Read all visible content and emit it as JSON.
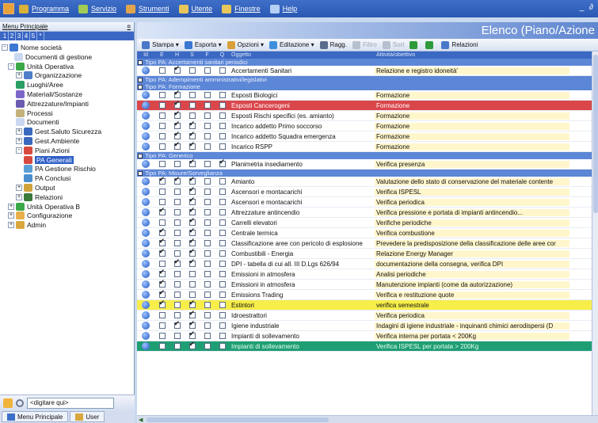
{
  "menubar": {
    "items": [
      {
        "label": "Programma",
        "icon": "program-icon",
        "color": "#d9b23a"
      },
      {
        "label": "Servizio",
        "icon": "service-icon",
        "color": "#a2cc55"
      },
      {
        "label": "Strumenti",
        "icon": "tools-icon",
        "color": "#e1a54d"
      },
      {
        "label": "Utente",
        "icon": "user-icon",
        "color": "#e7c65a"
      },
      {
        "label": "Finestre",
        "icon": "windows-icon",
        "color": "#e7c65a"
      },
      {
        "label": "Help",
        "icon": "help-icon",
        "color": "#b6cff5"
      }
    ],
    "window_controls": "_ ∂"
  },
  "left_panel": {
    "title": "Menu Principale",
    "pin": "¤",
    "tabs": [
      "1",
      "2",
      "3",
      "4",
      "5",
      "*"
    ],
    "tree": [
      {
        "label": "Nome società",
        "exp": "-",
        "icon": "company-icon",
        "color": "#3b77d3"
      },
      {
        "label": "Documenti di gestione",
        "exp": "",
        "icon": "documents-icon",
        "color": "#c9d7f0"
      },
      {
        "label": "Unità Operativa",
        "exp": "-",
        "icon": "unit-icon",
        "color": "#3aa847"
      },
      {
        "label": "Organizzazione",
        "exp": "+",
        "icon": "organization-icon",
        "color": "#4f7ec8"
      },
      {
        "label": "Luoghi/Aree",
        "exp": "",
        "icon": "places-icon",
        "color": "#2a9e63"
      },
      {
        "label": "Materiali/Sostanze",
        "exp": "",
        "icon": "materials-icon",
        "color": "#7c67c8"
      },
      {
        "label": "Attrezzature/Impianti",
        "exp": "",
        "icon": "equipment-icon",
        "color": "#6b5bb0"
      },
      {
        "label": "Processi",
        "exp": "",
        "icon": "processes-icon",
        "color": "#c3b27a"
      },
      {
        "label": "Documenti",
        "exp": "",
        "icon": "documents-icon",
        "color": "#c9d7f0"
      },
      {
        "label": "Gest.Saluto Sicurezza",
        "exp": "+",
        "icon": "safety-icon",
        "color": "#3a68bd"
      },
      {
        "label": "Gest.Ambiente",
        "exp": "+",
        "icon": "environment-icon",
        "color": "#3a68bd"
      },
      {
        "label": "Piani Azioni",
        "exp": "-",
        "icon": "action-plans-icon",
        "color": "#d84a3f"
      },
      {
        "label": "PA Generali",
        "exp": "",
        "icon": "pa-general-icon",
        "color": "#d84a3f"
      },
      {
        "label": "PA Gestione Rischio",
        "exp": "",
        "icon": "pa-risk-icon",
        "color": "#5aa0d8"
      },
      {
        "label": "PA Conclusi",
        "exp": "",
        "icon": "pa-closed-icon",
        "color": "#4b8fcf"
      },
      {
        "label": "Output",
        "exp": "+",
        "icon": "output-icon",
        "color": "#d0a33a"
      },
      {
        "label": "Relazioni",
        "exp": "+",
        "icon": "relations-icon",
        "color": "#3a7a3a"
      },
      {
        "label": "Unità Operativa B",
        "exp": "+",
        "icon": "unit-icon",
        "color": "#3aa847"
      },
      {
        "label": "Configurazione",
        "exp": "+",
        "icon": "config-icon",
        "color": "#e8b04a"
      },
      {
        "label": "Admin",
        "exp": "+",
        "icon": "admin-icon",
        "color": "#d9a73e"
      }
    ],
    "search_placeholder": "<digitare qui>",
    "bottom_tabs": [
      "Menu Principale",
      "User"
    ]
  },
  "right": {
    "title": "Elenco (Piano/Azione",
    "toolbar": [
      {
        "label": "Stampa ▾",
        "icon": "print-icon",
        "color": "#4a78c9",
        "disabled": false
      },
      {
        "label": "Esporta ▾",
        "icon": "export-icon",
        "color": "#3b77d3",
        "disabled": false
      },
      {
        "label": "Opzioni ▾",
        "icon": "options-icon",
        "color": "#d89f3a",
        "disabled": false
      },
      {
        "label": "Editazione ▾",
        "icon": "edit-icon",
        "color": "#3e8fdc",
        "disabled": false
      },
      {
        "label": "Ragg.",
        "icon": "group-icon",
        "color": "#5a6c8c",
        "disabled": false
      },
      {
        "label": "Filtro",
        "icon": "filter-icon",
        "color": "#b7c0cf",
        "disabled": true
      },
      {
        "label": "Sort",
        "icon": "sort-icon",
        "color": "#b7c0cf",
        "disabled": true
      },
      {
        "label": "",
        "icon": "down-arrow-icon",
        "color": "#2f9a3a",
        "disabled": false
      },
      {
        "label": "",
        "icon": "up-arrow-icon",
        "color": "#2f9a3a",
        "disabled": false
      },
      {
        "label": "Relazioni",
        "icon": "relations-icon",
        "color": "#4a78c9",
        "disabled": false
      }
    ],
    "columns": [
      "Id",
      "E",
      "H",
      "S",
      "F",
      "Q",
      "Oggetto",
      "Attività/obiettivo"
    ],
    "rows": [
      {
        "group": "Tipo PA: Accertamenti sanitari periodici"
      },
      {
        "c": [
          0,
          1,
          0,
          0,
          0
        ],
        "obj": "Accertamenti Sanitari",
        "act": "Relazione e registro idoneità'",
        "hl": ""
      },
      {
        "group": "Tipo PA: Adempimenti amministrativi/legislativi"
      },
      {
        "group": "Tipo PA: Formazione"
      },
      {
        "c": [
          0,
          1,
          0,
          0,
          0
        ],
        "obj": "Esposti Biologici",
        "act": "Formazione",
        "hl": ""
      },
      {
        "c": [
          0,
          1,
          0,
          0,
          0
        ],
        "obj": "Esposti Cancerogeni",
        "act": "Formazione",
        "hl": "red"
      },
      {
        "c": [
          0,
          1,
          0,
          0,
          0
        ],
        "obj": "Esposti Rischi specifici (es. amianto)",
        "act": "Formazione",
        "hl": ""
      },
      {
        "c": [
          0,
          1,
          1,
          0,
          0
        ],
        "obj": "Incarico addetto Primo soccorso",
        "act": "Formazione",
        "hl": ""
      },
      {
        "c": [
          0,
          1,
          1,
          0,
          0
        ],
        "obj": "Incarico addetto Squadra emergenza",
        "act": "Formazione",
        "hl": ""
      },
      {
        "c": [
          0,
          1,
          1,
          0,
          0
        ],
        "obj": "Incarico RSPP",
        "act": "Formazione",
        "hl": ""
      },
      {
        "group": "Tipo PA: Generico"
      },
      {
        "c": [
          0,
          0,
          1,
          0,
          1
        ],
        "obj": "Planimetria insediamento",
        "act": "Verifica presenza",
        "hl": ""
      },
      {
        "group": "Tipo PA: Misure/Sorveglianza"
      },
      {
        "c": [
          1,
          1,
          1,
          0,
          0
        ],
        "obj": "Amianto",
        "act": "Valutazione dello stato di conservazione del materiale contente",
        "hl": ""
      },
      {
        "c": [
          0,
          0,
          1,
          0,
          0
        ],
        "obj": "Ascensori e montacarichi",
        "act": "Verifica ISPESL",
        "hl": ""
      },
      {
        "c": [
          0,
          0,
          1,
          0,
          0
        ],
        "obj": "Ascensori e montacarichi",
        "act": "Verifica periodica",
        "hl": ""
      },
      {
        "c": [
          1,
          0,
          1,
          0,
          0
        ],
        "obj": "Attrezzature antincendio",
        "act": "Verifica pressione e portata di impianti antincendio...",
        "hl": ""
      },
      {
        "c": [
          0,
          0,
          1,
          0,
          0
        ],
        "obj": "Carrelli elevatori",
        "act": "Verifiche periodiche",
        "hl": ""
      },
      {
        "c": [
          1,
          0,
          1,
          0,
          0
        ],
        "obj": "Centrale termica",
        "act": "Verifica combustione",
        "hl": ""
      },
      {
        "c": [
          1,
          0,
          1,
          0,
          0
        ],
        "obj": "Classificazione aree con pericolo di esplosione",
        "act": "Prevedere la predisposizione della classificazione delle aree cor",
        "hl": ""
      },
      {
        "c": [
          1,
          0,
          1,
          0,
          0
        ],
        "obj": "Combustibili - Energia",
        "act": "Relazione Energy Manager",
        "hl": ""
      },
      {
        "c": [
          0,
          1,
          1,
          0,
          0
        ],
        "obj": "DPI - tabella di cui all. III D.Lgs 626/94",
        "act": "documentazione della consegna, verifica DPI",
        "hl": ""
      },
      {
        "c": [
          1,
          0,
          0,
          0,
          0
        ],
        "obj": "Emissioni in atmosfera",
        "act": "Analisi periodiche",
        "hl": ""
      },
      {
        "c": [
          1,
          0,
          0,
          0,
          0
        ],
        "obj": "Emissioni in atmosfera",
        "act": "Manutenzione impianti (come da autorizzazione)",
        "hl": ""
      },
      {
        "c": [
          1,
          0,
          0,
          0,
          0
        ],
        "obj": "Emissions Trading",
        "act": "Verifica e restituzione quote",
        "hl": ""
      },
      {
        "c": [
          1,
          0,
          1,
          0,
          0
        ],
        "obj": "Estintori",
        "act": "verifica semestrale",
        "hl": "yellow"
      },
      {
        "c": [
          0,
          0,
          1,
          0,
          0
        ],
        "obj": "Idroestrattori",
        "act": "Verifica periodica",
        "hl": ""
      },
      {
        "c": [
          0,
          1,
          1,
          0,
          0
        ],
        "obj": "Igiene industriale",
        "act": "Indagini di igiene industriale - inquinanti chimici aerodispersi (D",
        "hl": ""
      },
      {
        "c": [
          0,
          0,
          1,
          0,
          0
        ],
        "obj": "Impianti di sollevamento",
        "act": "Verifica interna per portata < 200Kg",
        "hl": ""
      },
      {
        "c": [
          0,
          0,
          1,
          0,
          0
        ],
        "obj": "Impianti di sollevamento",
        "act": "Verifica ISPESL per portata > 200Kg",
        "hl": "green"
      }
    ]
  }
}
